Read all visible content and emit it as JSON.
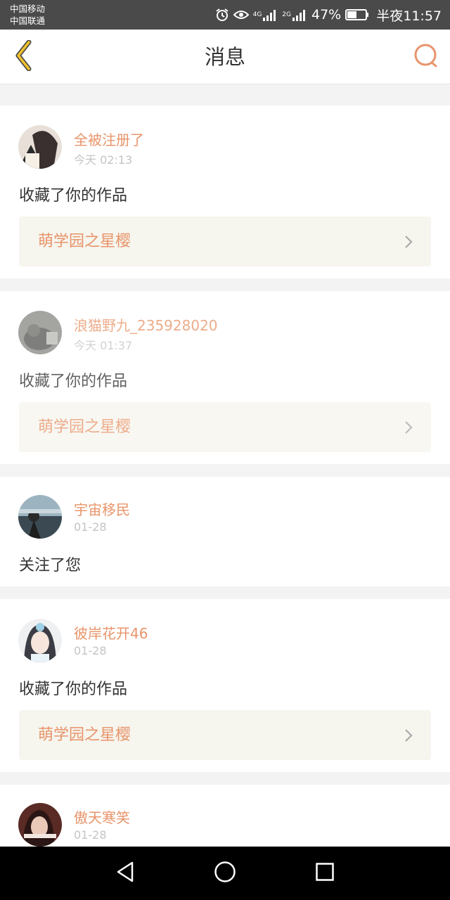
{
  "status_bar": {
    "carrier1": "中国移动",
    "carrier2": "中国联通",
    "net1": "4G",
    "net2": "2G",
    "battery": "47%",
    "time": "半夜11:57",
    "icons": [
      "alarm-icon",
      "eye-icon",
      "signal-icon",
      "battery-icon"
    ]
  },
  "header": {
    "title": "消息",
    "back_icon": "chevron-left-icon",
    "search_icon": "search-icon",
    "accent_color": "#e8946a",
    "back_color": "#f0c02c"
  },
  "messages": [
    {
      "user": "全被注册了",
      "time": "今天 02:13",
      "action": "收藏了你的作品",
      "work": "萌学园之星樱",
      "read": false
    },
    {
      "user": "浪猫野九_235928020",
      "time": "今天 01:37",
      "action": "收藏了你的作品",
      "work": "萌学园之星樱",
      "read": true
    },
    {
      "user": "宇宙移民",
      "time": "01-28",
      "action": "关注了您",
      "read": false
    },
    {
      "user": "彼岸花开46",
      "time": "01-28",
      "action": "收藏了你的作品",
      "work": "萌学园之星樱",
      "read": false
    },
    {
      "user": "傲天寒笑",
      "time": "01-28",
      "read": false
    }
  ],
  "system_nav": {
    "back_icon": "triangle-back-icon",
    "home_icon": "circle-home-icon",
    "recents_icon": "square-recents-icon"
  }
}
